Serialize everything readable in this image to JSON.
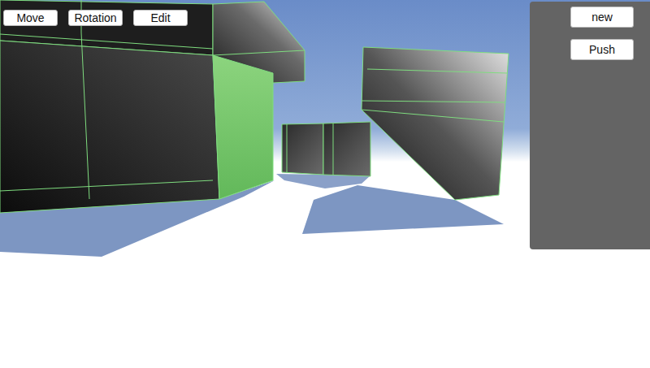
{
  "toolbar": {
    "buttons": [
      "Move",
      "Rotation",
      "Edit"
    ]
  },
  "panel": {
    "buttons": [
      "new",
      "Push"
    ]
  }
}
